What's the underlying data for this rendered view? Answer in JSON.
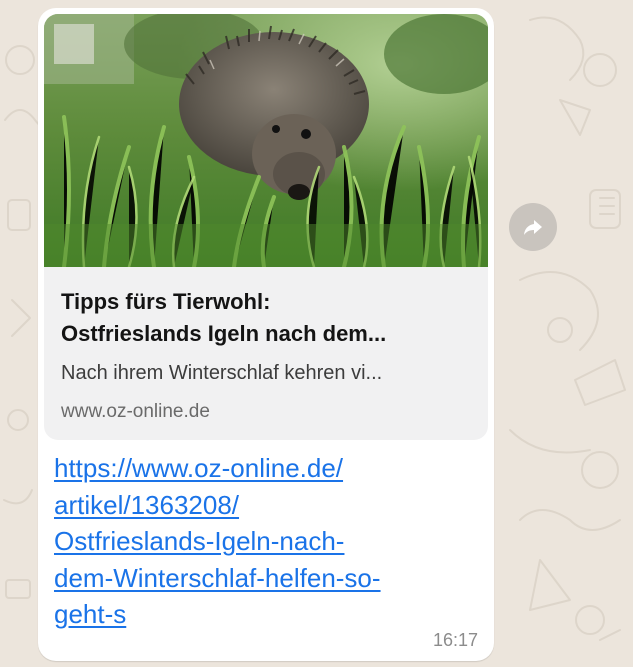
{
  "colors": {
    "chat_background": "#ece5dc",
    "bubble": "#ffffff",
    "preview_card": "#f1f1f2",
    "link": "#1a73e8",
    "timestamp": "#8c8c8c",
    "forward_button": "#c9c4be"
  },
  "message": {
    "preview": {
      "image_icon": "hedgehog-in-grass-photo",
      "title_line1": "Tipps fürs Tierwohl:",
      "title_line2": "Ostfrieslands Igeln nach dem...",
      "description": "Nach ihrem Winterschlaf kehren vi...",
      "domain": "www.oz-online.de"
    },
    "link_lines": [
      "https://www.oz-online.de/",
      "artikel/1363208/",
      "Ostfrieslands-Igeln-nach-",
      "dem-Winterschlaf-helfen-so-",
      "geht-s"
    ],
    "time": "16:17"
  },
  "actions": {
    "forward_icon": "forward-arrow-icon"
  }
}
